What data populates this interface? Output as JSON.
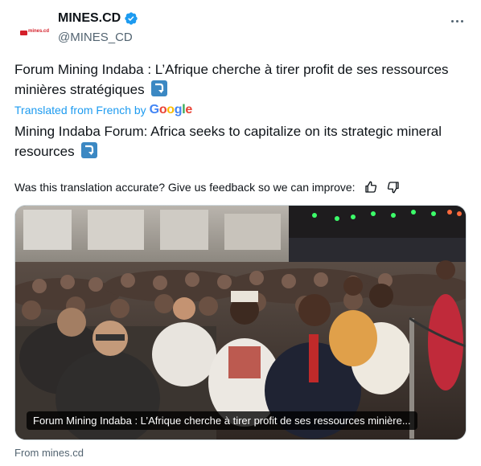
{
  "author": {
    "name": "MINES.CD",
    "handle": "@MINES_CD",
    "logo_text": "mines.cd"
  },
  "post": {
    "original_text": "Forum Mining Indaba : L’Afrique cherche à tirer profit de ses ressources minières stratégiques",
    "translated_from": "Translated from French by",
    "translated_by_brand": "Google",
    "translated_text": "Mining Indaba Forum: Africa seeks to capitalize on its strategic mineral resources",
    "emoji": "right-arrow-curving-down-icon"
  },
  "feedback": {
    "prompt": "Was this translation accurate? Give us feedback so we can improve:"
  },
  "media": {
    "caption": "Forum Mining Indaba : L’Afrique cherche à tirer profit de ses ressources minière...",
    "source": "From mines.cd"
  },
  "colors": {
    "link": "#1d9bf0",
    "verified": "#1d9bf0",
    "secondary_text": "#536471",
    "emoji_bg": "#3b88c3"
  }
}
